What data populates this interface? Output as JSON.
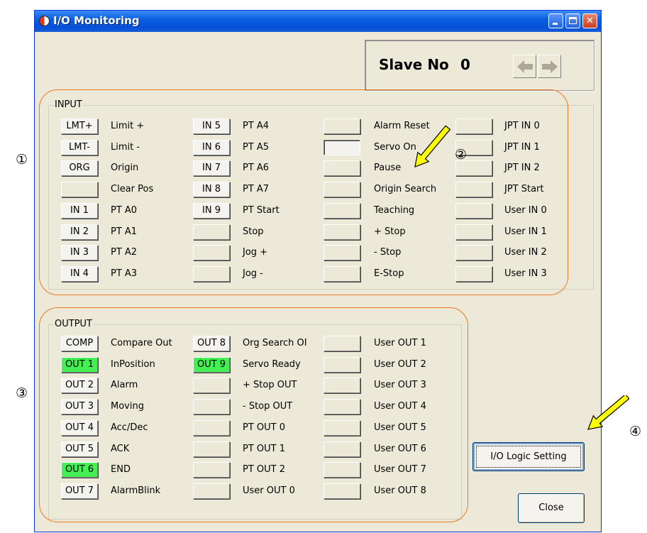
{
  "window": {
    "title": "I/O Monitoring"
  },
  "slave": {
    "label": "Slave No",
    "value": "0"
  },
  "input": {
    "title": "INPUT",
    "col1": [
      {
        "button": "LMT+",
        "label": "Limit +"
      },
      {
        "button": "LMT-",
        "label": "Limit -"
      },
      {
        "button": "ORG",
        "label": "Origin"
      },
      {
        "button": "",
        "label": "Clear Pos"
      },
      {
        "button": "IN 1",
        "label": "PT A0"
      },
      {
        "button": "IN 2",
        "label": "PT A1"
      },
      {
        "button": "IN 3",
        "label": "PT A2"
      },
      {
        "button": "IN 4",
        "label": "PT A3"
      }
    ],
    "col2": [
      {
        "button": "IN 5",
        "label": "PT A4"
      },
      {
        "button": "IN 6",
        "label": "PT A5"
      },
      {
        "button": "IN 7",
        "label": "PT A6"
      },
      {
        "button": "IN 8",
        "label": "PT A7"
      },
      {
        "button": "IN 9",
        "label": "PT Start"
      },
      {
        "button": "",
        "label": "Stop"
      },
      {
        "button": "",
        "label": "Jog +"
      },
      {
        "button": "",
        "label": "Jog -"
      }
    ],
    "col3": [
      {
        "button": "",
        "label": "Alarm Reset"
      },
      {
        "button": "",
        "label": "Servo On"
      },
      {
        "button": "",
        "label": "Pause"
      },
      {
        "button": "",
        "label": "Origin Search"
      },
      {
        "button": "",
        "label": "Teaching"
      },
      {
        "button": "",
        "label": "+ Stop"
      },
      {
        "button": "",
        "label": "- Stop"
      },
      {
        "button": "",
        "label": "E-Stop"
      }
    ],
    "col4": [
      {
        "button": "",
        "label": "JPT IN 0"
      },
      {
        "button": "",
        "label": "JPT IN 1"
      },
      {
        "button": "",
        "label": "JPT IN 2"
      },
      {
        "button": "",
        "label": "JPT Start"
      },
      {
        "button": "",
        "label": "User IN 0"
      },
      {
        "button": "",
        "label": "User IN 1"
      },
      {
        "button": "",
        "label": "User IN 2"
      },
      {
        "button": "",
        "label": "User IN 3"
      }
    ]
  },
  "output": {
    "title": "OUTPUT",
    "col1": [
      {
        "button": "COMP",
        "label": "Compare Out"
      },
      {
        "button": "OUT 1",
        "label": "InPosition"
      },
      {
        "button": "OUT 2",
        "label": "Alarm"
      },
      {
        "button": "OUT 3",
        "label": "Moving"
      },
      {
        "button": "OUT 4",
        "label": "Acc/Dec"
      },
      {
        "button": "OUT 5",
        "label": "ACK"
      },
      {
        "button": "OUT 6",
        "label": "END"
      },
      {
        "button": "OUT 7",
        "label": "AlarmBlink"
      }
    ],
    "col2": [
      {
        "button": "OUT 8",
        "label": "Org Search OI"
      },
      {
        "button": "OUT 9",
        "label": "Servo Ready"
      },
      {
        "button": "",
        "label": "+ Stop OUT"
      },
      {
        "button": "",
        "label": "- Stop OUT"
      },
      {
        "button": "",
        "label": "PT OUT 0"
      },
      {
        "button": "",
        "label": "PT OUT 1"
      },
      {
        "button": "",
        "label": "PT OUT 2"
      },
      {
        "button": "",
        "label": "User OUT 0"
      }
    ],
    "col3": [
      {
        "button": "",
        "label": "User OUT 1"
      },
      {
        "button": "",
        "label": "User OUT 2"
      },
      {
        "button": "",
        "label": "User OUT 3"
      },
      {
        "button": "",
        "label": "User OUT 4"
      },
      {
        "button": "",
        "label": "User OUT 5"
      },
      {
        "button": "",
        "label": "User OUT 6"
      },
      {
        "button": "",
        "label": "User OUT 7"
      },
      {
        "button": "",
        "label": "User OUT 8"
      }
    ]
  },
  "active_indicators": [
    "OUT 1",
    "OUT 6",
    "OUT 9"
  ],
  "buttons": {
    "logic_setting": "I/O Logic Setting",
    "close": "Close"
  },
  "annotations": {
    "n1": "①",
    "n2": "②",
    "n3": "③",
    "n4": "④"
  },
  "colors": {
    "active": "#44ef53",
    "highlight": "#f07820",
    "pointer": "#ffff00",
    "titlebar": "#0a5fe0"
  },
  "icons": [
    "io-monitor-icon",
    "minimize-icon",
    "maximize-icon",
    "close-icon",
    "arrow-left-icon",
    "arrow-right-icon",
    "pointer-arrow-icon"
  ]
}
